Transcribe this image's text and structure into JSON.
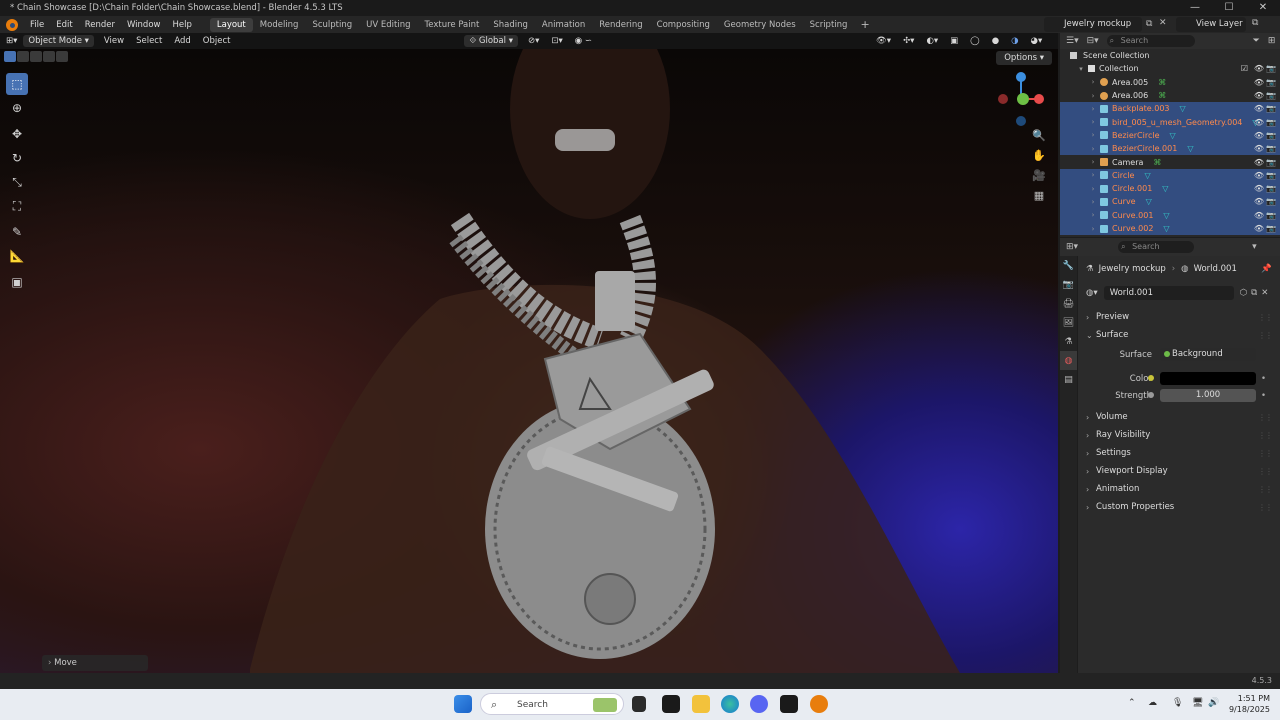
{
  "window": {
    "title": "* Chain Showcase [D:\\Chain Folder\\Chain Showcase.blend] - Blender 4.5.3 LTS",
    "controls": [
      "—",
      "☐",
      "✕"
    ]
  },
  "menu": {
    "items": [
      "File",
      "Edit",
      "Render",
      "Window",
      "Help"
    ],
    "workspaces": [
      "Layout",
      "Modeling",
      "Sculpting",
      "UV Editing",
      "Texture Paint",
      "Shading",
      "Animation",
      "Rendering",
      "Compositing",
      "Geometry Nodes",
      "Scripting"
    ],
    "active_workspace": "Layout",
    "add_workspace": "+",
    "scene": "Jewelry mockup",
    "view_layer": "View Layer"
  },
  "viewport_header": {
    "mode": "Object Mode",
    "menus": [
      "View",
      "Select",
      "Add",
      "Object"
    ],
    "orientation": "Global",
    "options": "Options"
  },
  "viewport": {
    "last_operator": "Move",
    "gizmo_colors": {
      "x": "#e84b4b",
      "y": "#6ec045",
      "z": "#3c8fe0"
    }
  },
  "outliner": {
    "search_placeholder": "Search",
    "root": "Scene Collection",
    "collection": "Collection",
    "items": [
      {
        "name": "Area.005",
        "type": "light",
        "selected": false
      },
      {
        "name": "Area.006",
        "type": "light",
        "selected": false
      },
      {
        "name": "Backplate.003",
        "type": "mesh",
        "selected": true
      },
      {
        "name": "bird_005_u_mesh_Geometry.004",
        "type": "mesh",
        "selected": true
      },
      {
        "name": "BezierCircle",
        "type": "curve",
        "selected": true
      },
      {
        "name": "BezierCircle.001",
        "type": "curve",
        "selected": true
      },
      {
        "name": "Camera",
        "type": "camera",
        "selected": false
      },
      {
        "name": "Circle",
        "type": "curve",
        "selected": true
      },
      {
        "name": "Circle.001",
        "type": "curve",
        "selected": true
      },
      {
        "name": "Curve",
        "type": "curve",
        "selected": true
      },
      {
        "name": "Curve.001",
        "type": "curve",
        "selected": true
      },
      {
        "name": "Curve.002",
        "type": "curve",
        "selected": true
      }
    ]
  },
  "properties": {
    "search_placeholder": "Search",
    "breadcrumb_scene": "Jewelry mockup",
    "breadcrumb_world": "World.001",
    "world_name": "World.001",
    "panels": {
      "preview": "Preview",
      "surface": "Surface",
      "volume": "Volume",
      "ray_visibility": "Ray Visibility",
      "settings": "Settings",
      "viewport_display": "Viewport Display",
      "animation": "Animation",
      "custom_properties": "Custom Properties"
    },
    "surface": {
      "surface_label": "Surface",
      "surface_value": "Background",
      "color_label": "Color",
      "color_value": "#000000",
      "strength_label": "Strength",
      "strength_value": "1.000"
    }
  },
  "statusbar": {
    "version": "4.5.3"
  },
  "taskbar": {
    "search": "Search",
    "time": "1:51 PM",
    "date": "9/18/2025"
  }
}
